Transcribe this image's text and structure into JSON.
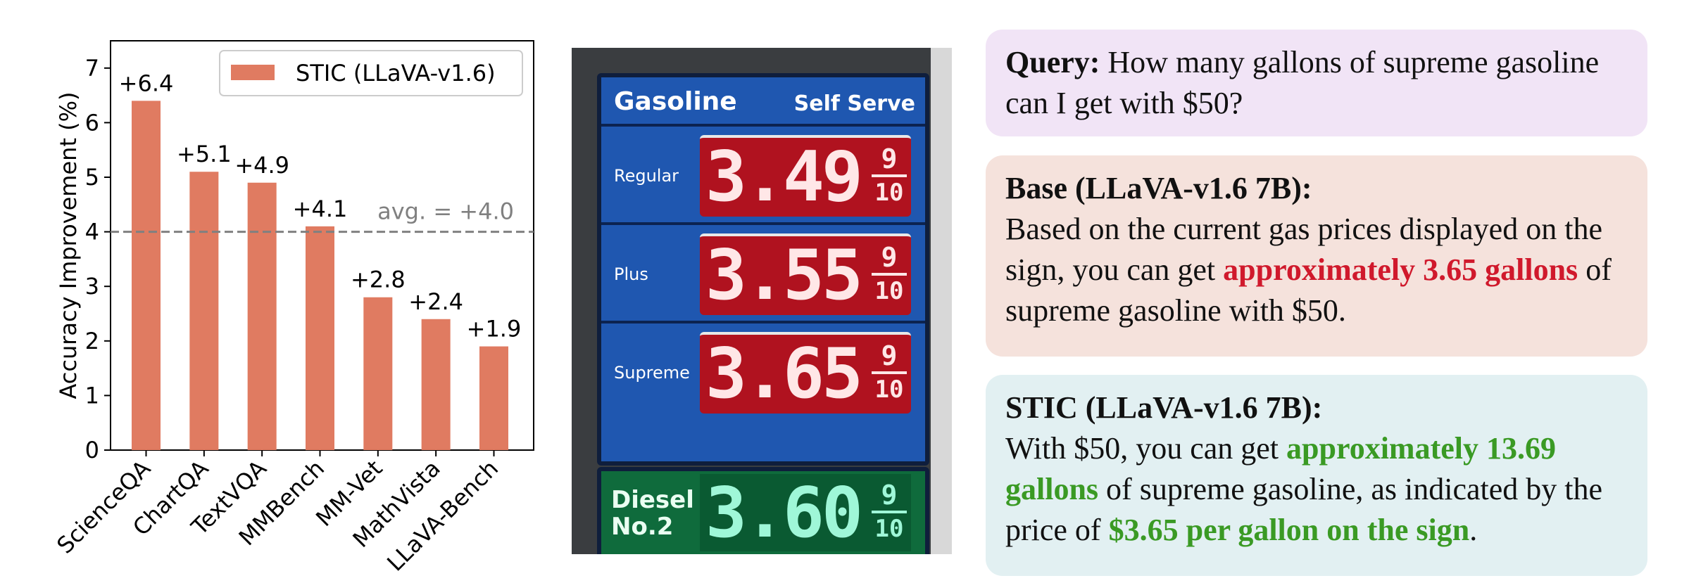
{
  "chart_data": {
    "type": "bar",
    "categories": [
      "ScienceQA",
      "ChartQA",
      "TextVQA",
      "MMBench",
      "MM-Vet",
      "MathVista",
      "LLaVA-Bench"
    ],
    "series": [
      {
        "name": "STIC (LLaVA-v1.6)",
        "values": [
          6.4,
          5.1,
          4.9,
          4.1,
          2.8,
          2.4,
          1.9
        ],
        "color": "#e07b61"
      }
    ],
    "data_labels": [
      "+6.4",
      "+5.1",
      "+4.9",
      "+4.1",
      "+2.8",
      "+2.4",
      "+1.9"
    ],
    "ylabel": "Accuracy Improvement (%)",
    "xlabel": "",
    "ylim": [
      0,
      7.5
    ],
    "yticks": [
      0,
      1,
      2,
      3,
      4,
      5,
      6,
      7
    ],
    "reference_line": {
      "value": 4.0,
      "label": "avg. = +4.0",
      "style": "dashed",
      "color": "#808080"
    },
    "legend": {
      "position": "top-right",
      "entries": [
        "STIC (LLaVA-v1.6)"
      ]
    },
    "grid": false
  },
  "sign": {
    "brand": "Gasoline",
    "self_serve": "Self Serve",
    "rows": [
      {
        "grade": "Regular",
        "price": "3.49",
        "frac_num": "9",
        "frac_den": "10"
      },
      {
        "grade": "Plus",
        "price": "3.55",
        "frac_num": "9",
        "frac_den": "10"
      },
      {
        "grade": "Supreme",
        "price": "3.65",
        "frac_num": "9",
        "frac_den": "10"
      }
    ],
    "diesel": {
      "label_line1": "Diesel",
      "label_line2": "No.2",
      "price": "3.60",
      "frac_num": "9",
      "frac_den": "10"
    }
  },
  "query": {
    "label": "Query:",
    "text": " How many gallons of supreme gasoline can I get with $50?"
  },
  "base": {
    "title": "Base (LLaVA-v1.6 7B):",
    "text_before": "Based on the current gas prices displayed on the sign, you can get ",
    "highlight": "approximately 3.65 gallons",
    "text_after": " of supreme gasoline with $50.",
    "highlight_color": "#d0192c"
  },
  "stic": {
    "title": "STIC (LLaVA-v1.6 7B):",
    "text_before": "With $50, you can get ",
    "highlight1": "approximately 13.69 gallons",
    "text_middle": " of supreme gasoline, as indicated by the price of ",
    "highlight2": "$3.65 per gallon on the sign",
    "text_after": ".",
    "highlight_color": "#3a9a24"
  }
}
